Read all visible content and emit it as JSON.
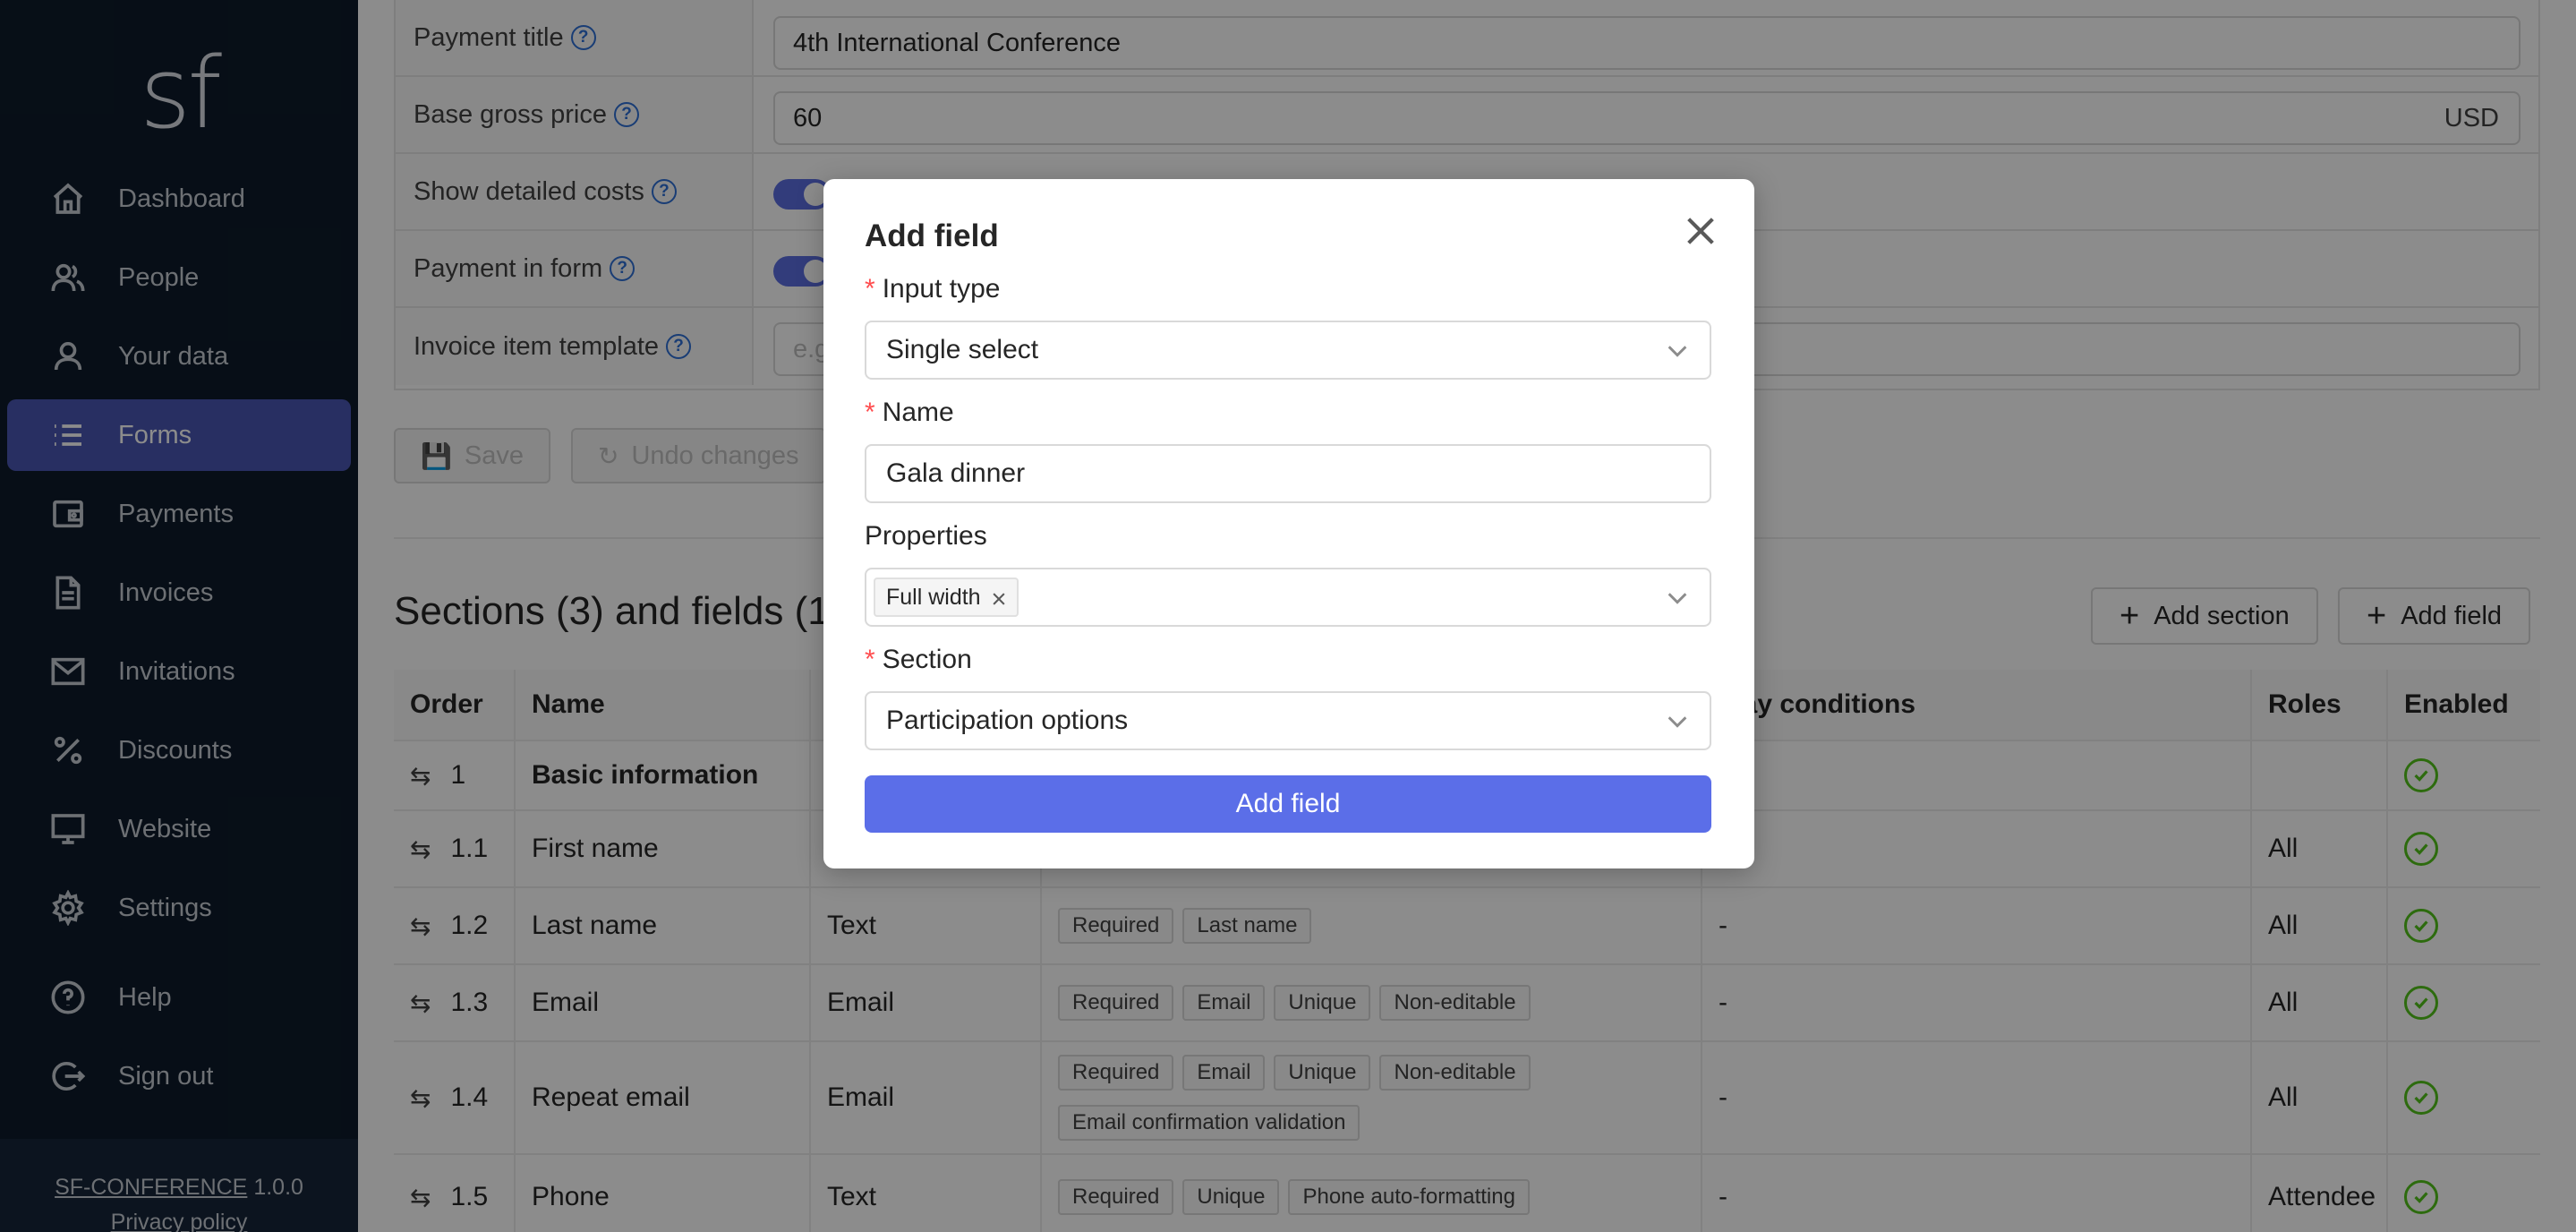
{
  "app": {
    "logo": "sf",
    "version_link": "SF-CONFERENCE",
    "version": "1.0.0",
    "privacy": "Privacy policy"
  },
  "sidebar": {
    "items": [
      {
        "label": "Dashboard",
        "icon": "home-icon"
      },
      {
        "label": "People",
        "icon": "people-icon"
      },
      {
        "label": "Your data",
        "icon": "user-icon"
      },
      {
        "label": "Forms",
        "icon": "list-icon",
        "active": true
      },
      {
        "label": "Payments",
        "icon": "wallet-icon"
      },
      {
        "label": "Invoices",
        "icon": "document-icon"
      },
      {
        "label": "Invitations",
        "icon": "mail-icon"
      },
      {
        "label": "Discounts",
        "icon": "percent-icon"
      },
      {
        "label": "Website",
        "icon": "monitor-icon"
      },
      {
        "label": "Settings",
        "icon": "gear-icon"
      },
      {
        "label": "Help",
        "icon": "help-icon"
      },
      {
        "label": "Sign out",
        "icon": "logout-icon"
      }
    ]
  },
  "form": {
    "payment_title_label": "Payment title",
    "payment_title_value": "4th International Conference",
    "base_price_label": "Base gross price",
    "base_price_value": "60",
    "base_price_currency": "USD",
    "detailed_costs_label": "Show detailed costs",
    "payment_in_form_label": "Payment in form",
    "invoice_template_label": "Invoice item template",
    "invoice_template_placeholder": "e.g.",
    "save_label": "Save",
    "undo_label": "Undo changes"
  },
  "sections": {
    "title": "Sections (3) and fields (1",
    "add_section": "Add section",
    "add_field": "Add field",
    "columns": {
      "order": "Order",
      "name": "Name",
      "type": "",
      "properties": "",
      "conditions": "play conditions",
      "roles": "Roles",
      "enabled": "Enabled"
    },
    "rows": [
      {
        "order": "1",
        "name": "Basic information",
        "type": "",
        "props": [],
        "props2": [],
        "cond": "",
        "roles": "",
        "bold": true
      },
      {
        "order": "1.1",
        "name": "First name",
        "type": "",
        "props": [],
        "props2": [],
        "cond": "-",
        "roles": "All"
      },
      {
        "order": "1.2",
        "name": "Last name",
        "type": "Text",
        "props": [
          "Required",
          "Last name"
        ],
        "props2": [],
        "cond": "-",
        "roles": "All"
      },
      {
        "order": "1.3",
        "name": "Email",
        "type": "Email",
        "props": [
          "Required",
          "Email",
          "Unique",
          "Non-editable"
        ],
        "props2": [],
        "cond": "-",
        "roles": "All"
      },
      {
        "order": "1.4",
        "name": "Repeat email",
        "type": "Email",
        "props": [
          "Required",
          "Email",
          "Unique",
          "Non-editable"
        ],
        "props2": [
          "Email confirmation validation"
        ],
        "cond": "-",
        "roles": "All"
      },
      {
        "order": "1.5",
        "name": "Phone",
        "type": "Text",
        "props": [
          "Required",
          "Unique",
          "Phone auto-formatting"
        ],
        "props2": [],
        "cond": "-",
        "roles": "Attendee"
      }
    ]
  },
  "modal": {
    "title": "Add field",
    "input_type_label": "Input type",
    "input_type_value": "Single select",
    "name_label": "Name",
    "name_value": "Gala dinner",
    "properties_label": "Properties",
    "properties_chip": "Full width",
    "section_label": "Section",
    "section_value": "Participation options",
    "submit_label": "Add field"
  },
  "colors": {
    "sidebar_bg": "#0d1b2a",
    "active": "#4a56b3",
    "primary": "#5b6ee8",
    "success": "#52c41a"
  }
}
